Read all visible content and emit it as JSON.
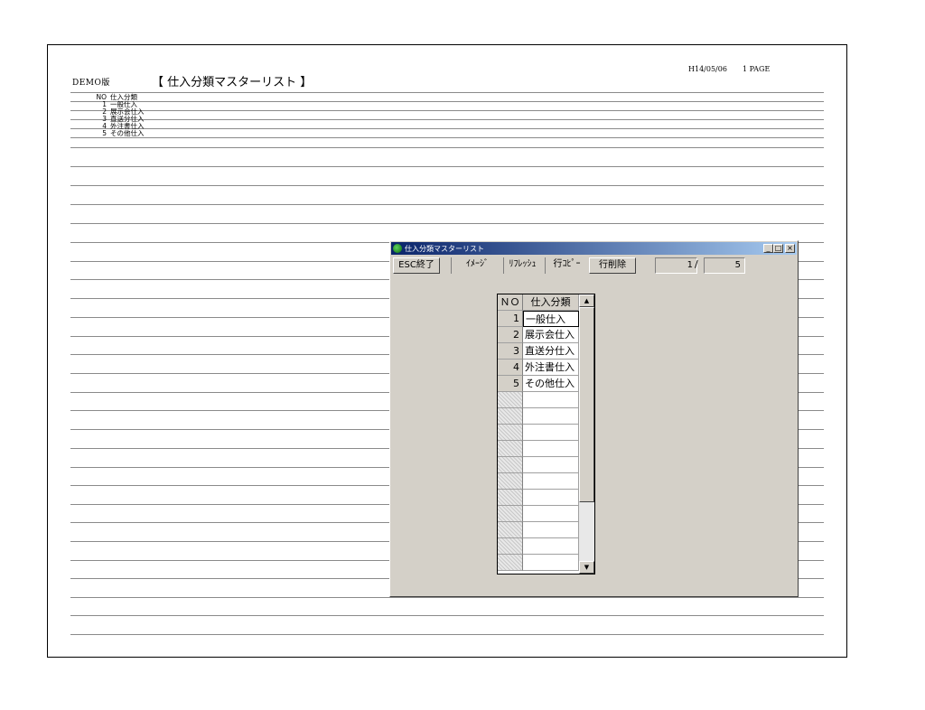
{
  "report": {
    "edition": "DEMO版",
    "title": "【 仕入分類マスターリスト 】",
    "date": "H14/05/06",
    "page": "1 PAGE",
    "header_no": "NO",
    "header_name": "仕入分類",
    "rows": [
      {
        "no": "1",
        "name": "一般仕入"
      },
      {
        "no": "2",
        "name": "展示会仕入"
      },
      {
        "no": "3",
        "name": "直送分仕入"
      },
      {
        "no": "4",
        "name": "外注書仕入"
      },
      {
        "no": "5",
        "name": "その他仕入"
      }
    ]
  },
  "window": {
    "title": "仕入分類マスターリスト",
    "controls": {
      "minimize": "_",
      "maximize": "□",
      "close": "×"
    },
    "toolbar": {
      "esc_label": "ESC終了",
      "image_label": "ｲﾒｰｼﾞ",
      "refresh_label": "ﾘﾌﾚｯｼｭ",
      "copy_row_label": "行ｺﾋﾟｰ",
      "delete_row_label": "行削除"
    },
    "page_current": "1",
    "page_separator": "/",
    "page_total": "5",
    "grid": {
      "header_no": "ＮＯ",
      "header_name": "仕入分類",
      "rows": [
        {
          "no": "1",
          "name": "一般仕入"
        },
        {
          "no": "2",
          "name": "展示会仕入"
        },
        {
          "no": "3",
          "name": "直送分仕入"
        },
        {
          "no": "4",
          "name": "外注書仕入"
        },
        {
          "no": "5",
          "name": "その他仕入"
        }
      ],
      "selected_row": 1
    }
  }
}
